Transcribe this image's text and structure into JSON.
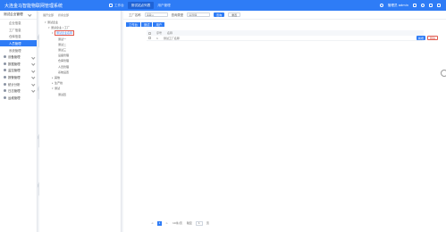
{
  "app": {
    "title": "大连金马智能物联网管理系统"
  },
  "top_tabs": [
    {
      "label": "工作台"
    },
    {
      "label": "测试站点列表"
    },
    {
      "label": "用户管理"
    }
  ],
  "top_right": {
    "user": "管理员 admin"
  },
  "sidebar": {
    "header": "测试企业管理",
    "items": [
      {
        "label": "企业信息"
      },
      {
        "label": "工厂信息"
      },
      {
        "label": "仓库信息"
      },
      {
        "label": "人员管理"
      },
      {
        "label": "系统管理"
      },
      {
        "label": "设备管理"
      },
      {
        "label": "数据管理"
      },
      {
        "label": "监控管理"
      },
      {
        "label": "报警管理"
      },
      {
        "label": "统计分析"
      },
      {
        "label": "日志管理"
      },
      {
        "label": "运维管理"
      }
    ]
  },
  "tree": {
    "tools": [
      "展开全部",
      "折叠全部"
    ],
    "nodes": [
      {
        "label": "测试企业"
      },
      {
        "label": "测试企业 / 工厂"
      },
      {
        "label": "测试企业名称"
      },
      {
        "label": "测试一"
      },
      {
        "label": "测试二"
      },
      {
        "label": "测试三"
      },
      {
        "label": "设备管理"
      },
      {
        "label": "仓库管理"
      },
      {
        "label": "人员管理"
      },
      {
        "label": "系统设置"
      },
      {
        "label": "其他"
      },
      {
        "label": "生产线"
      },
      {
        "label": "测试"
      },
      {
        "label": "测试四"
      }
    ]
  },
  "toolbar": {
    "label1": "工厂名称",
    "placeholder1": "请输入",
    "label2": "查询类型",
    "placeholder2": "请选择",
    "search": "查询",
    "reset": "重置"
  },
  "tabs": [
    "工作台",
    "测试",
    "用户"
  ],
  "table": {
    "headers": [
      "序号",
      "名称"
    ],
    "rows": [
      {
        "name": "测试工厂名称"
      }
    ]
  },
  "side_buttons": {
    "add": "新增",
    "delete": "删除"
  },
  "pager": {
    "current": "1",
    "items": [
      "<",
      "1",
      ">",
      "10条/页",
      "跳至",
      "页"
    ]
  },
  "watermark": "仅测试"
}
